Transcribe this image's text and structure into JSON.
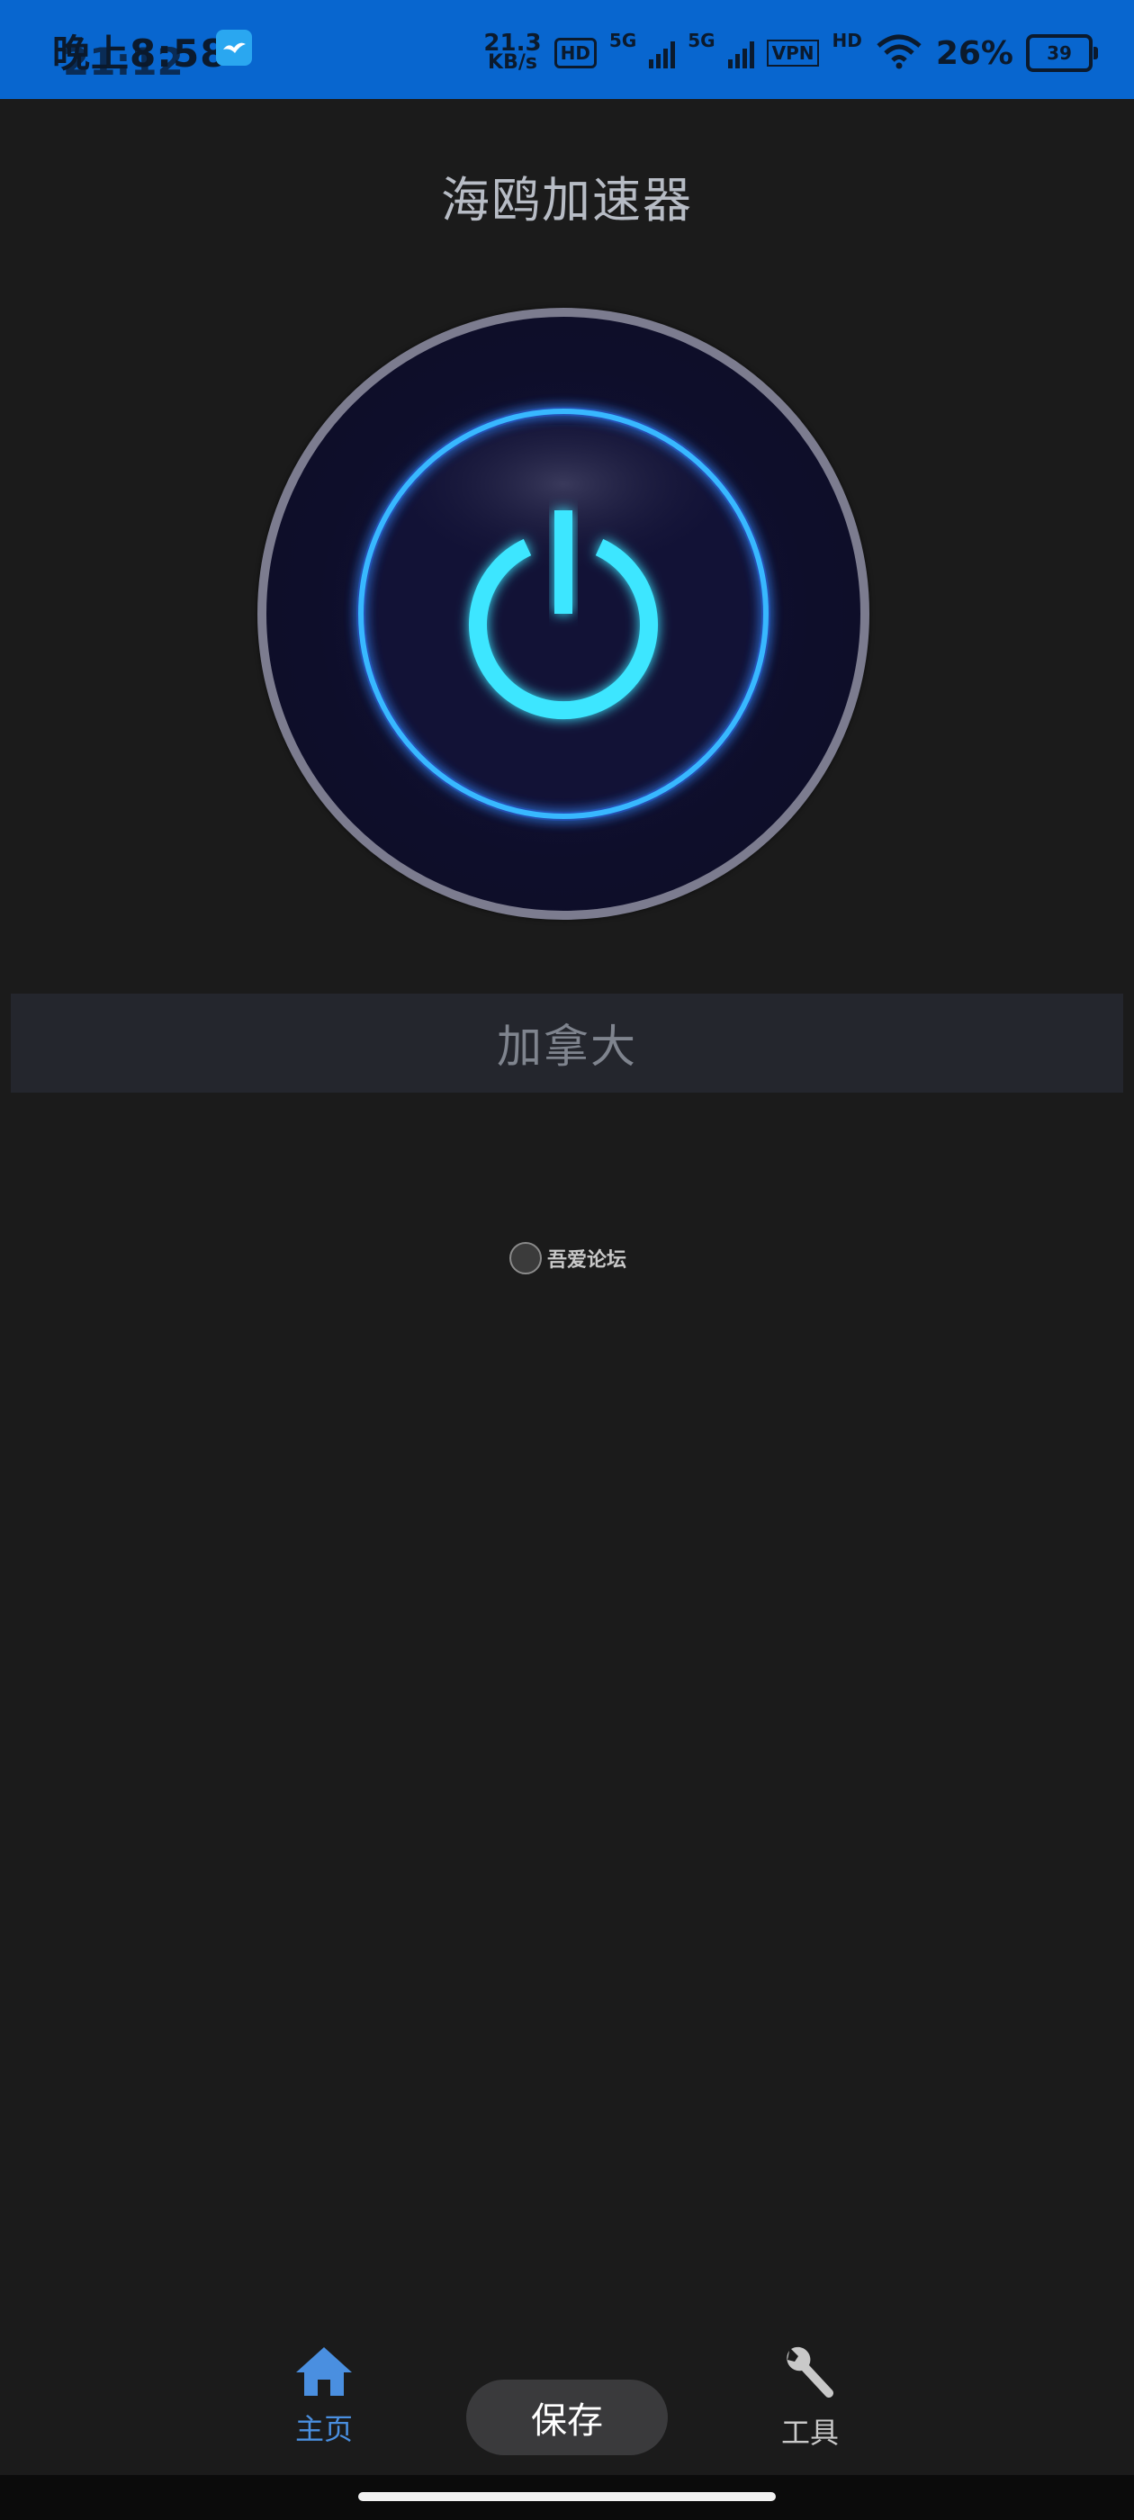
{
  "status_bar": {
    "time": "晚上8:58",
    "time_overlay": "21:12",
    "net_speed_value": "21.3",
    "net_speed_unit": "KB/s",
    "hd_label": "HD",
    "sim1_label": "5G",
    "sim2_label": "5G",
    "vpn_label": "VPN",
    "wifi_hd_label": "HD",
    "battery_percent": "26%",
    "battery_level": "39"
  },
  "header": {
    "title": "海鸥加速器"
  },
  "power_button": {
    "icon": "power-icon",
    "ring_color": "#35c7ff",
    "icon_color": "#3ee6ff"
  },
  "region": {
    "selected": "加拿大"
  },
  "watermark": {
    "text": "吾爱论坛"
  },
  "bottom_nav": {
    "home_label": "主页",
    "home_icon": "home-icon",
    "save_label": "保存",
    "tools_label": "工具",
    "tools_icon": "wrench-icon",
    "active_color": "#4a8fe0"
  }
}
